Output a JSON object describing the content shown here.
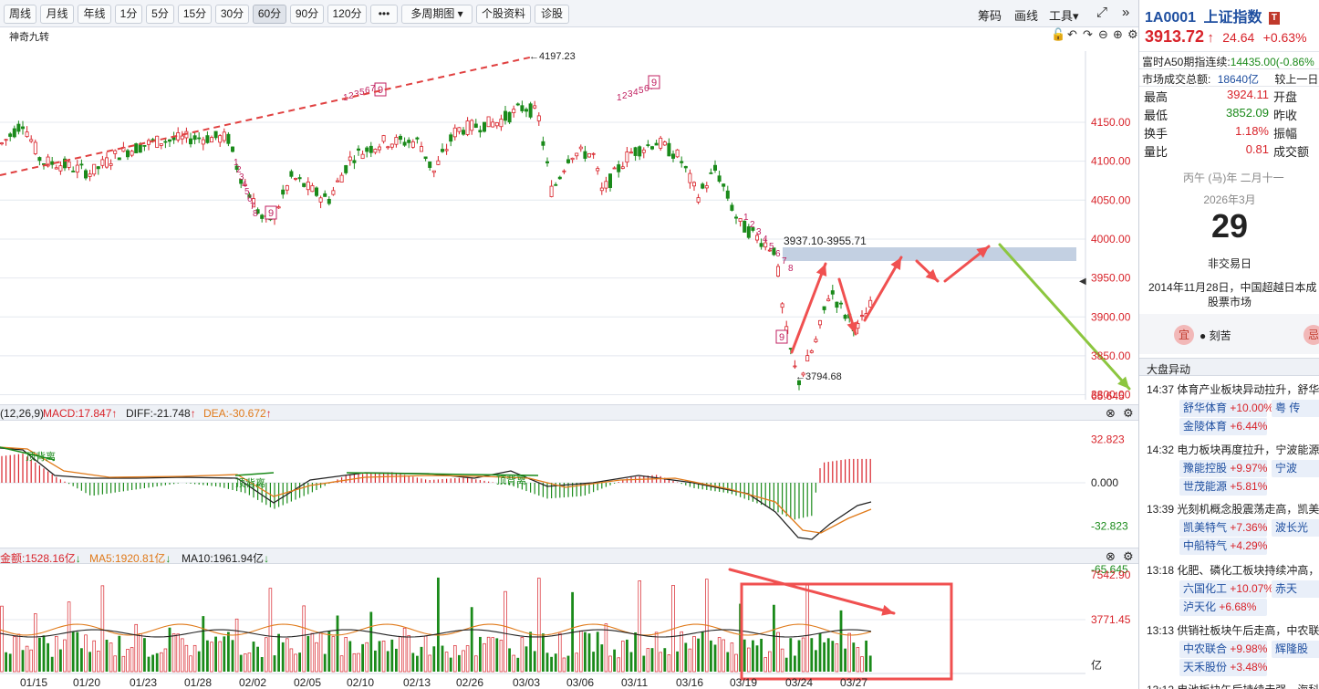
{
  "toolbar": {
    "buttons": [
      "周线",
      "月线",
      "年线",
      "1分",
      "5分",
      "15分",
      "30分",
      "60分",
      "90分",
      "120分",
      "•••",
      "多周期图 ▾",
      "个股资料",
      "诊股"
    ],
    "active": "60分",
    "right": [
      "筹码",
      "画线",
      "工具▾"
    ],
    "expand_icon": "⤢",
    "collapse_icon": "»"
  },
  "indicator_label": "神奇九转",
  "price_axis": [
    "4150.00",
    "4100.00",
    "4050.00",
    "4000.00",
    "3950.00",
    "3900.00",
    "3850.00",
    "3800.00"
  ],
  "annotations": {
    "high": "←4197.23",
    "low": "←3794.68",
    "zone": "3937.10-3955.71"
  },
  "td_sequences": [
    {
      "labels": [
        "1",
        "2",
        "3",
        "4",
        "5",
        "6",
        "7",
        "8",
        "9"
      ]
    },
    {
      "labels": [
        "1",
        "2",
        "3",
        "5",
        "6",
        "7",
        "8",
        "9"
      ]
    },
    {
      "labels": [
        "1",
        "2",
        "3",
        "4",
        "5",
        "6",
        "7",
        "8",
        "9"
      ]
    },
    {
      "labels": [
        "1",
        "2",
        "3",
        "4",
        "5",
        "6",
        "7",
        "8",
        "9"
      ]
    }
  ],
  "macd": {
    "params": "(12,26,9)",
    "macd": "MACD:17.847",
    "diff": "DIFF:-21.748",
    "dea": "DEA:-30.672",
    "axis": [
      "65.645",
      "32.823",
      "0.000",
      "-32.823",
      "-65.645"
    ],
    "div_labels": [
      "顶背离",
      "顶背离",
      "顶背离"
    ]
  },
  "volume": {
    "amount": "金额:1528.16亿",
    "ma5": "MA5:1920.81亿",
    "ma10": "MA10:1961.94亿",
    "axis": [
      "7542.90",
      "3771.45"
    ],
    "unit": "亿"
  },
  "date_axis": [
    "01/15",
    "01/20",
    "01/23",
    "01/28",
    "02/02",
    "02/05",
    "02/10",
    "02/13",
    "02/26",
    "03/03",
    "03/06",
    "03/11",
    "03/16",
    "03/19",
    "03/24",
    "03/27"
  ],
  "colors": {
    "up": "#d8232a",
    "down": "#1a8a1a",
    "accent": "#1f6fd1",
    "zone": "#b9c8dd"
  },
  "quote": {
    "code": "1A0001",
    "name": "上证指数",
    "badge": "T",
    "price": "3913.72",
    "arrow": "↑",
    "change": "24.64",
    "change_pct": "+0.63%",
    "futures_label": "富时A50期指连续:",
    "futures_value": "14435.00(-0.86%",
    "turnover_label": "市场成交总额:",
    "turnover_value": "18640亿",
    "compare_label": "较上一日",
    "rows": [
      {
        "label": "最高",
        "value": "3924.11",
        "label2": "开盘"
      },
      {
        "label": "最低",
        "value": "3852.09",
        "label2": "昨收"
      },
      {
        "label": "换手",
        "value": "1.18%",
        "label2": "振幅"
      },
      {
        "label": "量比",
        "value": "0.81",
        "label2": "成交额"
      }
    ]
  },
  "calendar": {
    "lunar": "丙午 (马)年 二月十一",
    "month": "2026年3月",
    "day": "29",
    "status": "非交易日",
    "event": "2014年11月28日，中国超越日本成",
    "event2": "股票市场",
    "yi": "宜",
    "yi_text": "● 刻苦",
    "ji": "忌"
  },
  "news_title": "大盘异动",
  "news": [
    {
      "time": "14:37",
      "text": "体育产业板块异动拉升，舒华",
      "chips": [
        {
          "name": "舒华体育",
          "pct": "+10.00%"
        },
        {
          "name": "粤 传",
          "pct": ""
        },
        {
          "name": "金陵体育",
          "pct": "+6.44%"
        }
      ]
    },
    {
      "time": "14:32",
      "text": "电力板块再度拉升，宁波能源",
      "chips": [
        {
          "name": "豫能控股",
          "pct": "+9.97%"
        },
        {
          "name": "宁波",
          "pct": ""
        },
        {
          "name": "世茂能源",
          "pct": "+5.81%"
        }
      ]
    },
    {
      "time": "13:39",
      "text": "光刻机概念股震荡走高，凯美",
      "chips": [
        {
          "name": "凯美特气",
          "pct": "+7.36%"
        },
        {
          "name": "波长光",
          "pct": ""
        },
        {
          "name": "中船特气",
          "pct": "+4.29%"
        }
      ]
    },
    {
      "time": "13:18",
      "text": "化肥、磷化工板块持续冲高，",
      "chips": [
        {
          "name": "六国化工",
          "pct": "+10.07%"
        },
        {
          "name": "赤天",
          "pct": ""
        },
        {
          "name": "泸天化",
          "pct": "+6.68%"
        }
      ]
    },
    {
      "time": "13:13",
      "text": "供销社板块午后走高，中农联",
      "chips": [
        {
          "name": "中农联合",
          "pct": "+9.98%"
        },
        {
          "name": "辉隆股",
          "pct": ""
        },
        {
          "name": "天禾股份",
          "pct": "+3.48%"
        }
      ]
    },
    {
      "time": "13:12",
      "text": "电池板块午后持续走强，海科",
      "chips": []
    }
  ]
}
